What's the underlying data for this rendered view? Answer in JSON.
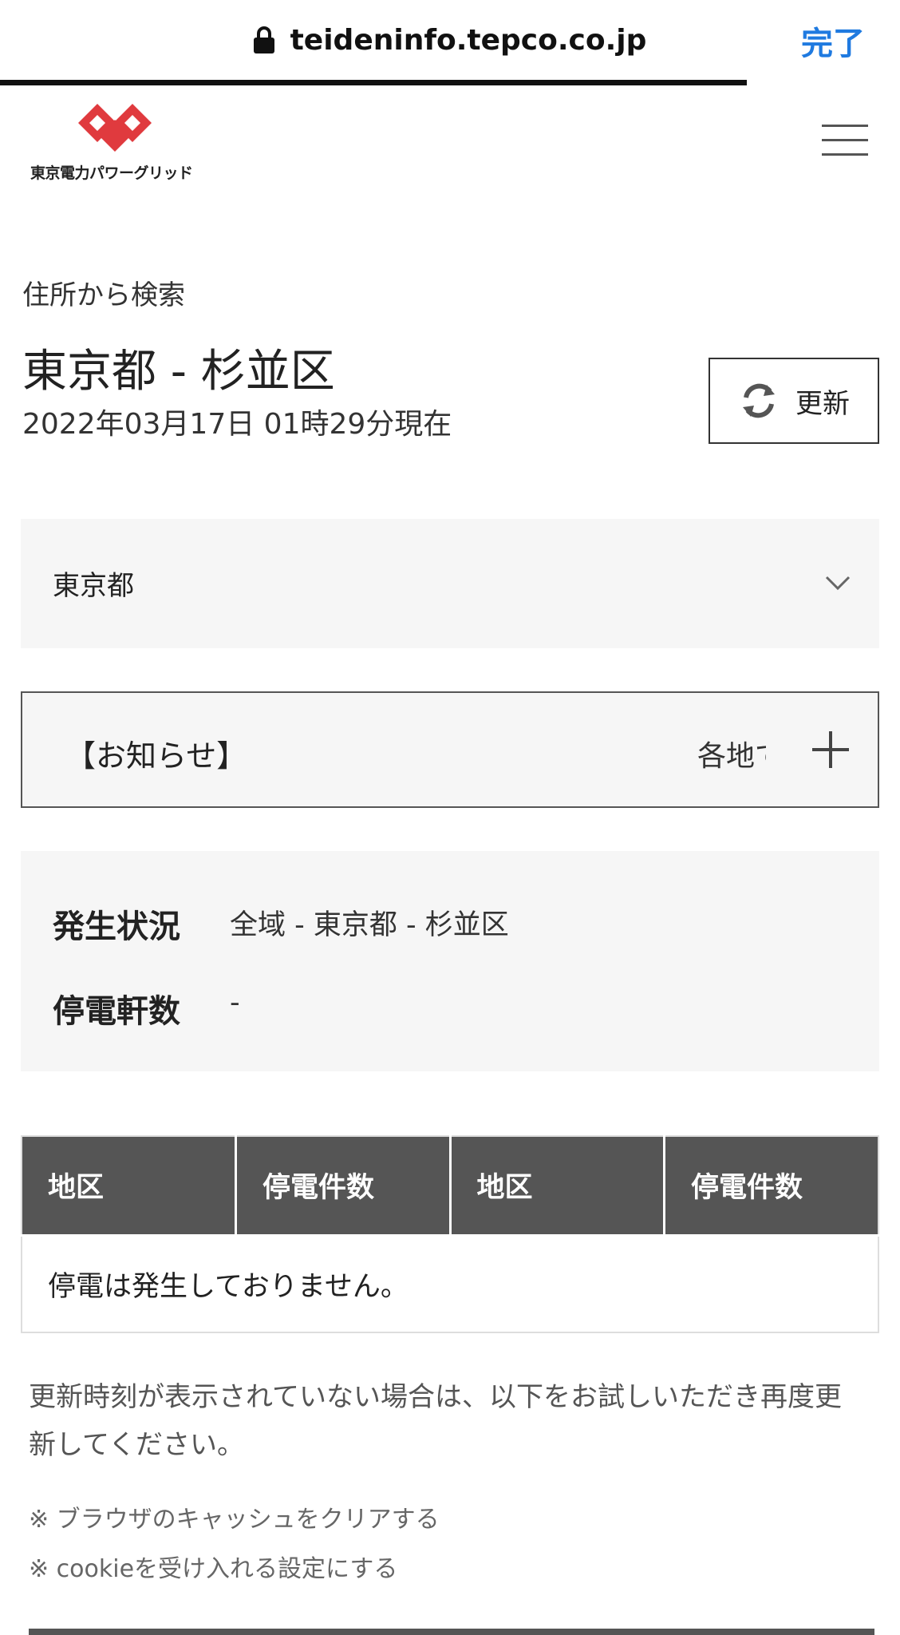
{
  "browser": {
    "url": "teideninfo.tepco.co.jp",
    "done_label": "完了"
  },
  "header": {
    "logo_text": "東京電力パワーグリッド",
    "logo_color": "#e03a3e",
    "menu_icon": "hamburger-menu-icon"
  },
  "page": {
    "subtitle": "住所から検索",
    "title": "東京都 - 杉並区",
    "timestamp": "2022年03月17日 01時29分現在",
    "refresh_label": "更新",
    "refresh_icon": "refresh-icon"
  },
  "prefecture_select": {
    "value": "東京都",
    "icon": "chevron-down-icon"
  },
  "notice": {
    "heading": "【お知らせ】",
    "preview": "各地で",
    "icon": "plus-icon"
  },
  "status": {
    "occurrence_label": "発生状況",
    "occurrence_value": "全域 - 東京都 - 杉並区",
    "outage_count_label": "停電軒数",
    "outage_count_value": "-"
  },
  "table": {
    "headers": [
      "地区",
      "停電件数",
      "地区",
      "停電件数"
    ],
    "empty_message": "停電は発生しておりません。"
  },
  "notes": {
    "main": "更新時刻が表示されていない場合は、以下をお試しいただき再度更新してください。",
    "tip1": "※  ブラウザのキャッシュをクリアする",
    "tip2": "※  cookieを受け入れる設定にする"
  },
  "colors": {
    "accent_blue": "#1f7ae0",
    "table_header": "#555555",
    "panel_bg": "#f6f6f6"
  }
}
